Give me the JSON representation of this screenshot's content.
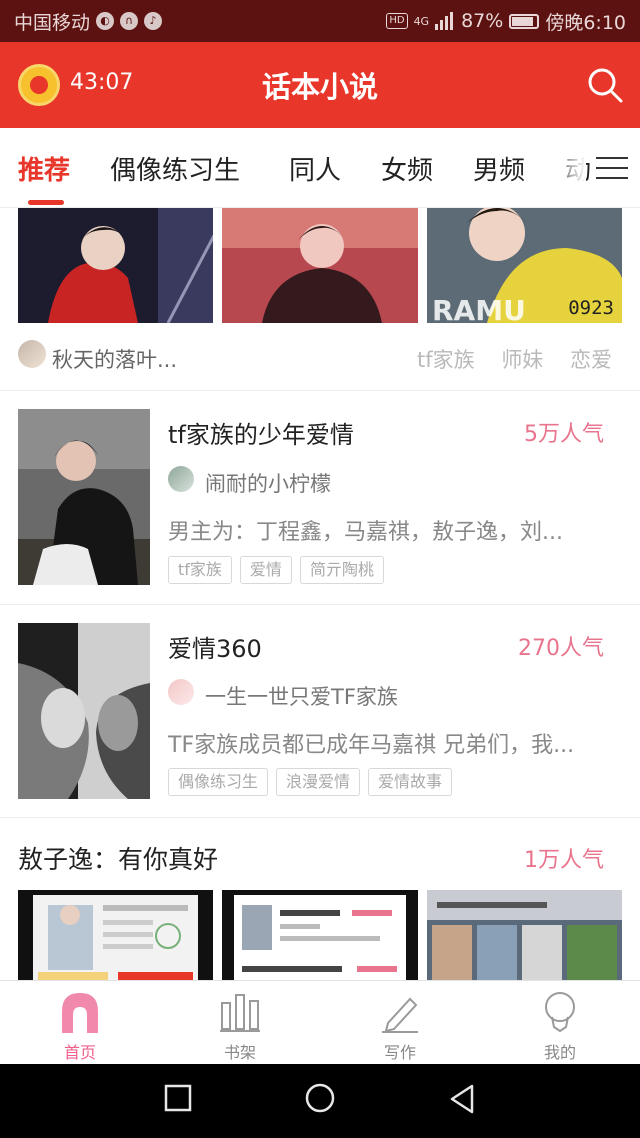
{
  "status_bar": {
    "carrier": "中国移动",
    "hd": "HD",
    "network": "4G",
    "battery": "87%",
    "time": "傍晚6:10"
  },
  "app_bar": {
    "timer": "43:07",
    "title": "话本小说"
  },
  "tabs": [
    {
      "label": "推荐",
      "active": true
    },
    {
      "label": "偶像练习生",
      "active": false
    },
    {
      "label": "同人",
      "active": false
    },
    {
      "label": "女频",
      "active": false
    },
    {
      "label": "男频",
      "active": false
    },
    {
      "label": "动",
      "active": false
    }
  ],
  "top_story": {
    "author": "秋天的落叶...",
    "tags": [
      "tf家族",
      "师妹",
      "恋爱"
    ],
    "thumb3_text": "0923"
  },
  "books": [
    {
      "title": "tf家族的少年爱情",
      "popularity": "5万人气",
      "author": "闹耐的小柠檬",
      "desc": "男主为：丁程鑫，马嘉祺，敖子逸，刘...",
      "tags": [
        "tf家族",
        "爱情",
        "简亓陶桃"
      ]
    },
    {
      "title": "爱情360",
      "popularity": "270人气",
      "author": "一生一世只爱TF家族",
      "desc": "TF家族成员都已成年马嘉祺 兄弟们，我...",
      "tags": [
        "偶像练习生",
        "浪漫爱情",
        "爱情故事"
      ]
    }
  ],
  "section": {
    "title": "敖子逸：有你真好",
    "popularity": "1万人气"
  },
  "bottom_nav": [
    {
      "label": "首页",
      "icon": "home-icon",
      "active": true
    },
    {
      "label": "书架",
      "icon": "bookshelf-icon",
      "active": false
    },
    {
      "label": "写作",
      "icon": "pen-icon",
      "active": false
    },
    {
      "label": "我的",
      "icon": "profile-icon",
      "active": false
    }
  ],
  "colors": {
    "accent": "#e8362a",
    "popularity": "#e9748d",
    "nav_active": "#ef5f8a"
  }
}
